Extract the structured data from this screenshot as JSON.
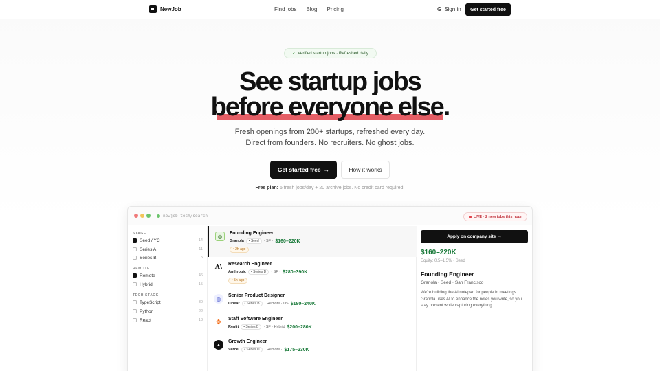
{
  "nav": {
    "brand": "NewJob",
    "links": [
      "Find jobs",
      "Blog",
      "Pricing"
    ],
    "signin": "Sign in",
    "signin_icon": "G",
    "cta": "Get started free"
  },
  "hero": {
    "badge": "Verified startup jobs · Refreshed daily",
    "badge_icon": "✓",
    "headline_1": "See startup jobs",
    "headline_2": "before everyone else.",
    "underline_color": "#e0424a",
    "sub_1": "Fresh openings from 200+ startups, refreshed every day.",
    "sub_2": "Direct from founders. No recruiters. No ghost jobs.",
    "primary_cta": "Get started free",
    "primary_arrow": "→",
    "secondary_cta": "How it works",
    "free_label": "Free plan:",
    "free_text": "5 fresh jobs/day + 20 archive jobs. No credit card required."
  },
  "browser": {
    "url": "newjob.tech/search",
    "live": "LIVE · 2 new jobs this hour",
    "filters": {
      "stage_title": "STAGE",
      "stage": [
        {
          "label": "Seed / YC",
          "count": "14",
          "checked": true
        },
        {
          "label": "Series A",
          "count": "11",
          "checked": false
        },
        {
          "label": "Series B",
          "count": "5",
          "checked": false
        }
      ],
      "remote_title": "REMOTE",
      "remote": [
        {
          "label": "Remote",
          "count": "46",
          "checked": true
        },
        {
          "label": "Hybrid",
          "count": "15",
          "checked": false
        }
      ],
      "tech_title": "TECH STACK",
      "tech": [
        {
          "label": "TypeScript",
          "count": "30",
          "checked": false
        },
        {
          "label": "Python",
          "count": "22",
          "checked": false
        },
        {
          "label": "React",
          "count": "18",
          "checked": false
        }
      ]
    },
    "jobs": [
      {
        "title": "Founding Engineer",
        "company": "Granola",
        "stage": "• Seed",
        "location": "· SF ·",
        "salary": "$160–220K",
        "ago": "• 2h ago"
      },
      {
        "title": "Research Engineer",
        "company": "Anthropic",
        "stage": "• Series D",
        "location": "· SF ·",
        "salary": "$280–390K",
        "ago": "• 5h ago"
      },
      {
        "title": "Senior Product Designer",
        "company": "Linear",
        "stage": "• Series B",
        "location": "· Remote · US",
        "salary": "$180–240K",
        "ago": ""
      },
      {
        "title": "Staff Software Engineer",
        "company": "Replit",
        "stage": "• Series B",
        "location": "· SF · Hybrid",
        "salary": "$200–280K",
        "ago": ""
      },
      {
        "title": "Growth Engineer",
        "company": "Vercel",
        "stage": "• Series D",
        "location": "· Remote ·",
        "salary": "$175–230K",
        "ago": ""
      }
    ],
    "detail": {
      "apply": "Apply on company site →",
      "salary": "$160–220K",
      "equity": "Equity: 0.5–1.5% · Seed",
      "title": "Founding Engineer",
      "company": "Granola · Seed · San Francisco",
      "description": "We're building the AI notepad for people in meetings. Granola uses AI to enhance the notes you write, so you stay present while capturing everything..."
    }
  }
}
